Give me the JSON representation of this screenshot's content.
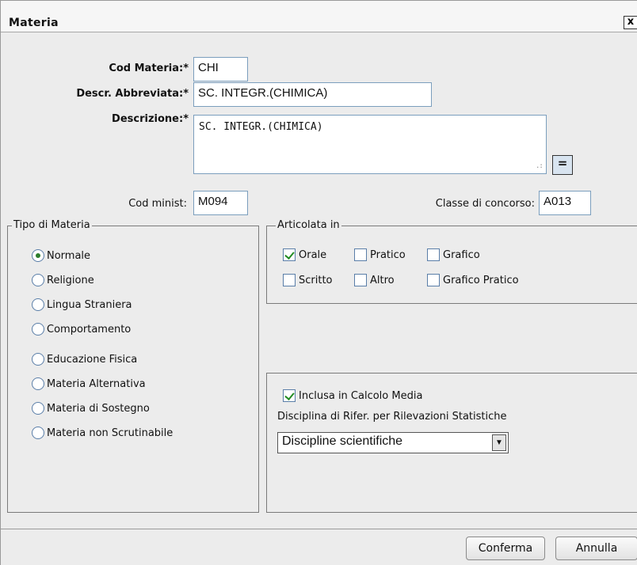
{
  "window": {
    "title": "Materia",
    "close_label": "x"
  },
  "form": {
    "cod_materia": {
      "label": "Cod Materia:*",
      "value": "CHI"
    },
    "descr_abbreviata": {
      "label": "Descr. Abbreviata:*",
      "value": "SC. INTEGR.(CHIMICA)"
    },
    "descrizione": {
      "label": "Descrizione:*",
      "value": "SC. INTEGR.(CHIMICA)",
      "expand_label": "="
    },
    "cod_minist": {
      "label": "Cod minist:",
      "value": "M094"
    },
    "classe_concorso": {
      "label": "Classe di concorso:",
      "value": "A013"
    }
  },
  "tipo_materia": {
    "legend": "Tipo di Materia",
    "options": [
      {
        "label": "Normale",
        "checked": true
      },
      {
        "label": "Religione",
        "checked": false
      },
      {
        "label": "Lingua Straniera",
        "checked": false
      },
      {
        "label": "Comportamento",
        "checked": false
      },
      {
        "label": "Educazione Fisica",
        "checked": false
      },
      {
        "label": "Materia Alternativa",
        "checked": false
      },
      {
        "label": "Materia di Sostegno",
        "checked": false
      },
      {
        "label": "Materia non Scrutinabile",
        "checked": false
      }
    ]
  },
  "articolata": {
    "legend": "Articolata in",
    "options": [
      {
        "label": "Orale",
        "checked": true
      },
      {
        "label": "Pratico",
        "checked": false
      },
      {
        "label": "Grafico",
        "checked": false
      },
      {
        "label": "Scritto",
        "checked": false
      },
      {
        "label": "Altro",
        "checked": false
      },
      {
        "label": "Grafico Pratico",
        "checked": false
      }
    ]
  },
  "calcolo": {
    "inclusa_label": "Inclusa in Calcolo Media",
    "inclusa_checked": true,
    "disciplina_label": "Disciplina di Rifer. per Rilevazioni Statistiche",
    "disciplina_selected": "Discipline scientifiche"
  },
  "buttons": {
    "confirm": "Conferma",
    "cancel": "Annulla"
  },
  "colors": {
    "accent_check": "#228b22",
    "field_border": "#7b9ebd"
  }
}
